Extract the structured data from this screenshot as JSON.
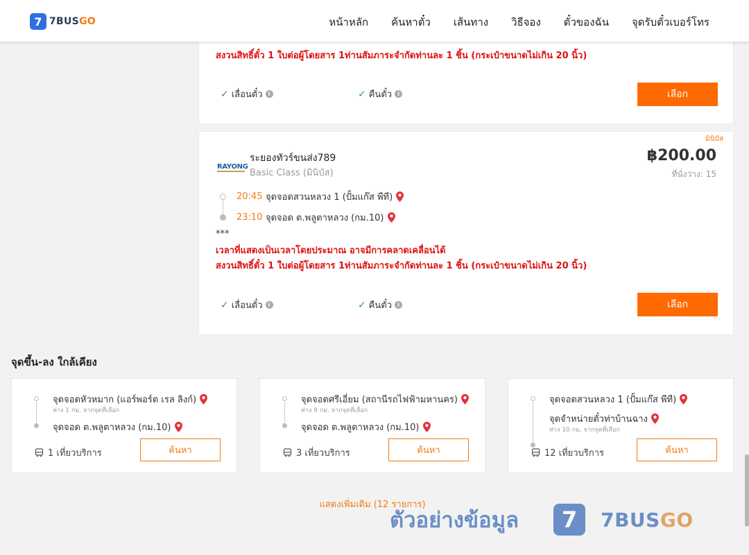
{
  "header": {
    "logo_badge": "7",
    "logo_text_main": "7BUS",
    "logo_text_accent": "GO",
    "nav": [
      "หน้าหลัก",
      "ค้นหาตั๋ว",
      "เส้นทาง",
      "วิธีจอง",
      "ตั๋วของฉัน",
      "จุดรับตั๋วเบอร์โทร"
    ]
  },
  "trip_prev": {
    "warning_line_2": "สงวนสิทธิ์ตั๋ว 1 ใบต่อผู้โดยสาร 1ท่านสัมภาระจำกัดท่านละ 1 ชิ้น (กระเป๋าขนาดไม่เกิน 20 นิ้ว)",
    "feature_change": "เลื่อนตั๋ว",
    "feature_refund": "คืนตั๋ว",
    "select_label": "เลือก"
  },
  "trip": {
    "tag": "มินิบัส",
    "operator_logo": "RAYONG",
    "operator": "ระยองทัวร์ขนส่ง789",
    "bus_class": "Basic Class (มินิบัส)",
    "price": "฿200.00",
    "seats": "ที่นั่งว่าง: 15",
    "depart_time": "20:45",
    "depart_stop": "จุดจอดสวนหลวง 1 (ปั้มแก๊ส พีที)",
    "arrive_time": "23:10",
    "arrive_stop": "จุดจอด ต.พลูตาหลวง (กม.10)",
    "stars": "***",
    "warning_line_1": "เวลาที่แสดงเป็นเวลาโดยประมาณ อาจมีการคลาดเคลื่อนได้",
    "warning_line_2": "สงวนสิทธิ์ตั๋ว 1 ใบต่อผู้โดยสาร 1ท่านสัมภาระจำกัดท่านละ 1 ชิ้น (กระเป๋าขนาดไม่เกิน 20 นิ้ว)",
    "feature_change": "เลื่อนตั๋ว",
    "feature_refund": "คืนตั๋ว",
    "select_label": "เลือก"
  },
  "nearby": {
    "title": "จุดขึ้น-ลง ใกล้เคียง",
    "cards": [
      {
        "from": "จุดจอดหัวหมาก (แอร์พอร์ต เรล ลิงก์)",
        "from_dist": "ห่าง 1 กม. จากจุดที่เลือก",
        "to": "จุดจอด ต.พลูตาหลวง (กม.10)",
        "to_dist": "",
        "trips": "1 เที่ยวบริการ",
        "search_label": "ค้นหา"
      },
      {
        "from": "จุดจอดศรีเอี่ยม (สถานีรถไฟฟ้ามหานคร)",
        "from_dist": "ห่าง 9 กม. จากจุดที่เลือก",
        "to": "จุดจอด ต.พลูตาหลวง (กม.10)",
        "to_dist": "",
        "trips": "3 เที่ยวบริการ",
        "search_label": "ค้นหา"
      },
      {
        "from": "จุดจอดสวนหลวง 1 (ปั้มแก๊ส พีที)",
        "from_dist": "",
        "to": "จุดจำหน่ายตั๋วท่าบ้านฉาง",
        "to_dist": "ห่าง 10 กม. จากจุดที่เลือก",
        "trips": "12 เที่ยวบริการ",
        "search_label": "ค้นหา"
      }
    ],
    "show_more": "แสดงเพิ่มเติม (12 รายการ)"
  },
  "watermark": {
    "text": "ตัวอย่างข้อมูล",
    "badge": "7",
    "brand_main": "7BUS",
    "brand_accent": "GO"
  },
  "colors": {
    "accent": "#ff6a00",
    "warning": "#e01010",
    "brand_blue": "#2f6fe0",
    "check": "#2e9d3a"
  }
}
